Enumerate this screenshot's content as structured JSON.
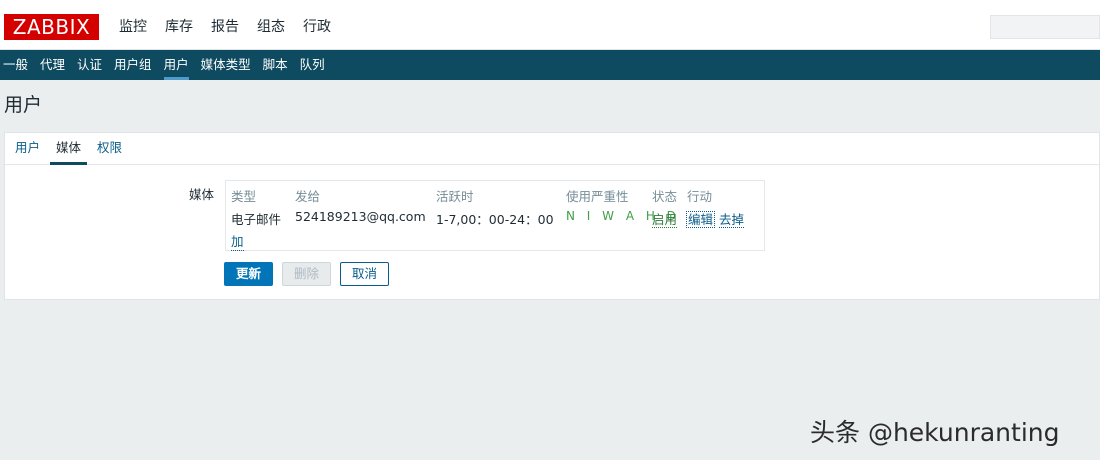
{
  "header": {
    "logo_text": "ZABBIX",
    "main_nav": [
      "监控",
      "库存",
      "报告",
      "组态",
      "行政"
    ]
  },
  "subnav": {
    "items": [
      "一般",
      "代理",
      "认证",
      "用户组",
      "用户",
      "媒体类型",
      "脚本",
      "队列"
    ],
    "active": "用户"
  },
  "page": {
    "title": "用户"
  },
  "tabs": {
    "items": [
      "用户",
      "媒体",
      "权限"
    ],
    "active": "媒体"
  },
  "media": {
    "label": "媒体",
    "headers": {
      "type": "类型",
      "send_to": "发给",
      "when_active": "活跃时",
      "use_if_severity": "使用严重性",
      "status": "状态",
      "action": "行动"
    },
    "rows": [
      {
        "type": "电子邮件",
        "send_to": "524189213@qq.com",
        "when_active": "1-7,00：00-24：00",
        "severity": "N I W A H D",
        "status": "启用",
        "edit": "编辑",
        "remove": "去掉"
      }
    ],
    "add_label": "加"
  },
  "buttons": {
    "update": "更新",
    "delete": "删除",
    "cancel": "取消"
  },
  "colors": {
    "logo_bg": "#d40000",
    "subnav_bg": "#0e4a60",
    "primary_button": "#0275b8",
    "link": "#0a5d8a",
    "status_enabled": "#2f7a3a",
    "severity": "#429e47"
  },
  "watermark": "头条 @hekunranting"
}
